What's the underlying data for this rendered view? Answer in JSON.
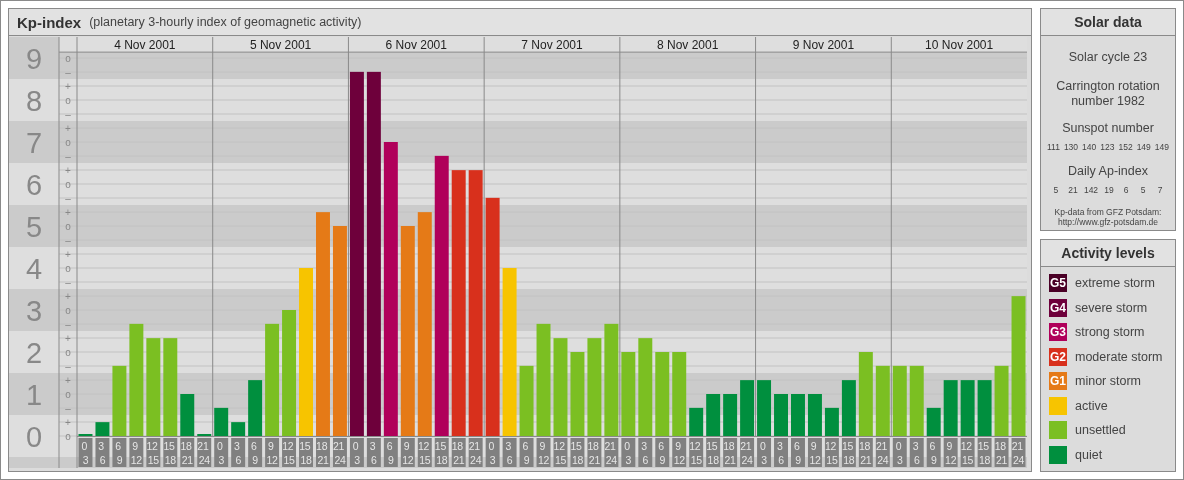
{
  "kp_panel": {
    "title": "Kp-index",
    "subtitle": "(planetary 3-hourly index of geomagnetic activity)",
    "days": [
      "4 Nov 2001",
      "5 Nov 2001",
      "6 Nov 2001",
      "7 Nov 2001",
      "8 Nov 2001",
      "9 Nov 2001",
      "10 Nov 2001"
    ],
    "minor_marks": [
      "o",
      "–",
      "+",
      "o",
      "–",
      "+",
      "o",
      "–",
      "+",
      "o",
      "–",
      "+",
      "o",
      "–",
      "+",
      "o",
      "–",
      "+",
      "o",
      "–",
      "+",
      "o",
      "–",
      "+",
      "o",
      "–",
      "+",
      "o"
    ],
    "chart_data": {
      "type": "bar",
      "ylim": [
        0,
        9.14
      ],
      "grid": true,
      "yticks": [
        {
          "value": 0,
          "label": "0"
        },
        {
          "value": 1,
          "label": "1"
        },
        {
          "value": 2,
          "label": "2"
        },
        {
          "value": 3,
          "label": "3"
        },
        {
          "value": 4,
          "label": "4"
        },
        {
          "value": 5,
          "label": "5"
        },
        {
          "value": 6,
          "label": "6"
        },
        {
          "value": 7,
          "label": "7"
        },
        {
          "value": 8,
          "label": "8"
        },
        {
          "value": 9,
          "label": "9"
        }
      ],
      "categories": [
        "0 3",
        "3 6",
        "6 9",
        "9 12",
        "12 15",
        "15 18",
        "18 21",
        "21 24",
        "0 3",
        "3 6",
        "6 9",
        "9 12",
        "12 15",
        "15 18",
        "18 21",
        "21 24",
        "0 3",
        "3 6",
        "6 9",
        "9 12",
        "12 15",
        "15 18",
        "18 21",
        "21 24",
        "0 3",
        "3 6",
        "6 9",
        "9 12",
        "12 15",
        "15 18",
        "18 21",
        "21 24",
        "0 3",
        "3 6",
        "6 9",
        "9 12",
        "12 15",
        "15 18",
        "18 21",
        "21 24",
        "0 3",
        "3 6",
        "6 9",
        "9 12",
        "12 15",
        "15 18",
        "18 21",
        "21 24",
        "0 3",
        "3 6",
        "6 9",
        "9 12",
        "12 15",
        "15 18",
        "18 21",
        "21 24"
      ],
      "values": [
        0,
        0.33,
        1.67,
        2.67,
        2.33,
        2.33,
        1,
        0,
        0.67,
        0.33,
        1.33,
        2.67,
        3,
        4,
        5.33,
        5,
        8.67,
        8.67,
        7,
        5,
        5.33,
        6.67,
        6.33,
        6.33,
        5.67,
        4,
        1.67,
        2.67,
        2.33,
        2,
        2.33,
        2.67,
        2,
        2.33,
        2,
        2,
        0.67,
        1,
        1,
        1.33,
        1.33,
        1,
        1,
        1,
        0.67,
        1.33,
        2,
        1.67,
        1.67,
        1.67,
        0.67,
        1.33,
        1.33,
        1.33,
        1.67,
        3.33
      ]
    }
  },
  "solar_data": {
    "title": "Solar data",
    "cycle": "Solar cycle 23",
    "carrington": "Carrington rotation number 1982",
    "sunspot_title": "Sunspot number",
    "sunspots": [
      "111",
      "130",
      "140",
      "123",
      "152",
      "149",
      "149"
    ],
    "ap_title": "Daily Ap-index",
    "ap": [
      "5",
      "21",
      "142",
      "19",
      "6",
      "5",
      "7"
    ],
    "source": "Kp-data from GFZ Potsdam:",
    "source_url": "http://www.gfz-potsdam.de"
  },
  "activity_levels": {
    "title": "Activity levels",
    "items": [
      {
        "badge": "G5",
        "label": "extreme storm",
        "color": "#4a0026"
      },
      {
        "badge": "G4",
        "label": "severe storm",
        "color": "#6e003b"
      },
      {
        "badge": "G3",
        "label": "strong storm",
        "color": "#b0005a"
      },
      {
        "badge": "G2",
        "label": "moderate storm",
        "color": "#d8301c"
      },
      {
        "badge": "G1",
        "label": "minor storm",
        "color": "#e57a17"
      },
      {
        "label": "active",
        "color": "#f7c400"
      },
      {
        "label": "unsettled",
        "color": "#7bbf22"
      },
      {
        "label": "quiet",
        "color": "#008f3e"
      }
    ]
  }
}
